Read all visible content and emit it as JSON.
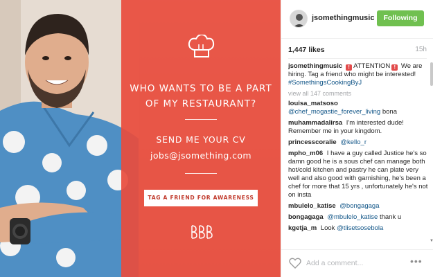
{
  "post_image": {
    "headline": "WHO WANTS TO BE A PART OF MY RESTAURANT?",
    "cv_title": "SEND ME YOUR CV",
    "email": "jobs@jsomething.com",
    "tag_button": "TAG A FRIEND FOR AWARENESS",
    "overlay_color": "#e84c3d",
    "icons": [
      "chef-hat-icon",
      "brand-monogram-icon"
    ]
  },
  "header": {
    "username": "jsomethingmusic",
    "follow_label": "Following",
    "follow_color": "#70c050"
  },
  "stats": {
    "likes": "1,447 likes",
    "time": "15h"
  },
  "caption": {
    "user": "jsomethingmusic",
    "pre": "ATTENTION",
    "text": "We are hiring. Tag a friend who might be interested!",
    "hashtag": "#SomethingsCookingByJ"
  },
  "view_all": "view all 147 comments",
  "comments": [
    {
      "user": "louisa_matsoso",
      "mention": "@chef_mogastie_forever_living",
      "text": "bona"
    },
    {
      "user": "muhammadalirsa",
      "text": "I'm interested dude! Remember me in your kingdom."
    },
    {
      "user": "princesscoralie",
      "mention": "@kello_r"
    },
    {
      "user": "mpho_m06",
      "text": "I have a guy called Justice he's so damn good he is a sous chef can manage both hot/cold kitchen and pastry he can plate very well and also good with garnishing, he's been a chef for more that 15 yrs , unfortunately he's not on insta"
    },
    {
      "user": "mbulelo_katise",
      "mention": "@bongagaga"
    },
    {
      "user": "bongagaga",
      "mention": "@mbulelo_katise",
      "text": "thank u"
    },
    {
      "user": "kgetja_m",
      "text": "Look",
      "mention": "@tlisetsosebola"
    }
  ],
  "footer": {
    "placeholder": "Add a comment...",
    "more_label": "•••"
  }
}
